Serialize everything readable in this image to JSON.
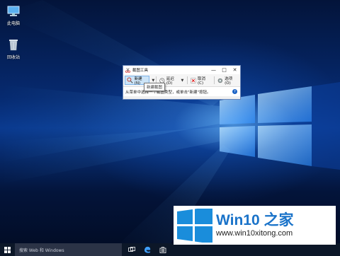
{
  "desktop": {
    "icons": [
      {
        "label": "此电脑",
        "icon": "this-pc-icon"
      },
      {
        "label": "回收站",
        "icon": "recycle-bin-icon"
      }
    ]
  },
  "snipping_tool": {
    "title": "截图工具",
    "buttons": {
      "new": "新建(N)",
      "delay": "延迟(D)",
      "cancel": "取消(C)",
      "options": "选项(O)"
    },
    "message": "从菜单中选择一个截图类型，或单击\"新建\"按钮。",
    "tooltip": "新建截图",
    "window_controls": {
      "minimize": "—",
      "maximize": "□",
      "close": "✕"
    }
  },
  "taskbar": {
    "search_placeholder": "搜索 Web 和 Windows",
    "icons": [
      "windows-start-icon",
      "task-view-icon",
      "edge-icon",
      "store-icon"
    ]
  },
  "watermark": {
    "title": "Win10 之家",
    "url": "www.win10xitong.com"
  },
  "colors": {
    "wallpaper": "#0a3a8f",
    "accent": "#1a73c9",
    "taskbar": "#0c1728"
  }
}
